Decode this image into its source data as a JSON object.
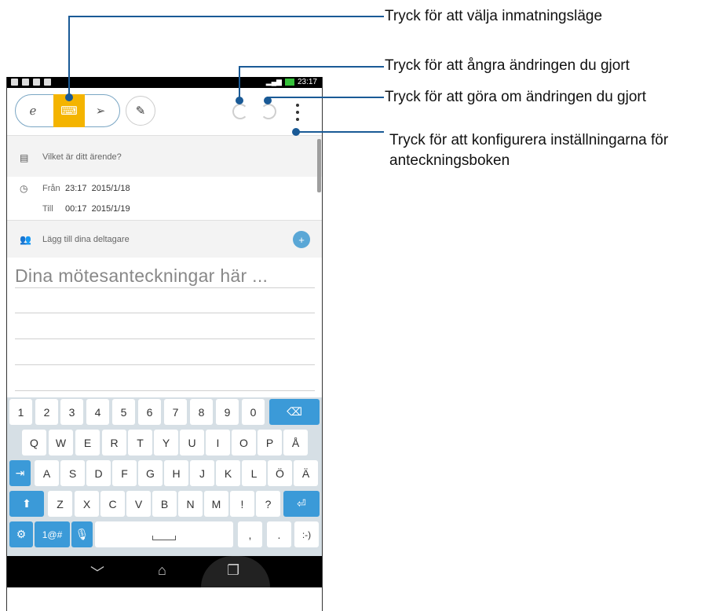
{
  "status_bar": {
    "time": "23:17"
  },
  "toolbar": {
    "modes": [
      {
        "icon": "handwriting-icon",
        "glyph": "ℯ"
      },
      {
        "icon": "keyboard-icon",
        "glyph": "⌨",
        "active": true
      },
      {
        "icon": "pen-icon",
        "glyph": "➢"
      }
    ],
    "brush_glyph": "✎"
  },
  "form": {
    "subject_placeholder": "Vilket är ditt ärende?",
    "from_label": "Från",
    "from_value": "23:17  2015/1/18",
    "to_label": "Till",
    "to_value": "00:17  2015/1/19",
    "participants_placeholder": "Lägg till dina deltagare"
  },
  "notes": {
    "placeholder": "Dina mötesanteckningar här ..."
  },
  "keyboard": {
    "row1": [
      "1",
      "2",
      "3",
      "4",
      "5",
      "6",
      "7",
      "8",
      "9",
      "0"
    ],
    "row2": [
      "Q",
      "W",
      "E",
      "R",
      "T",
      "Y",
      "U",
      "I",
      "O",
      "P",
      "Å"
    ],
    "row3": [
      "A",
      "S",
      "D",
      "F",
      "G",
      "H",
      "J",
      "K",
      "L",
      "Ö",
      "Ä"
    ],
    "row4": [
      "Z",
      "X",
      "C",
      "V",
      "B",
      "N",
      "M",
      "!",
      "?"
    ],
    "symbols_label": "1@#",
    "smiley_label": ":-)",
    "comma": ",",
    "period": "."
  },
  "callouts": {
    "mode": "Tryck för att välja inmatningsläge",
    "undo": "Tryck för att ångra ändringen du gjort",
    "redo": "Tryck för att göra om ändringen du gjort",
    "settings_line1": "Tryck för att konfigurera inställningarna för",
    "settings_line2": "anteckningsboken"
  },
  "colors": {
    "accent": "#f4b400",
    "key_blue": "#3b9ad8",
    "callout_line": "#1a5a96"
  }
}
